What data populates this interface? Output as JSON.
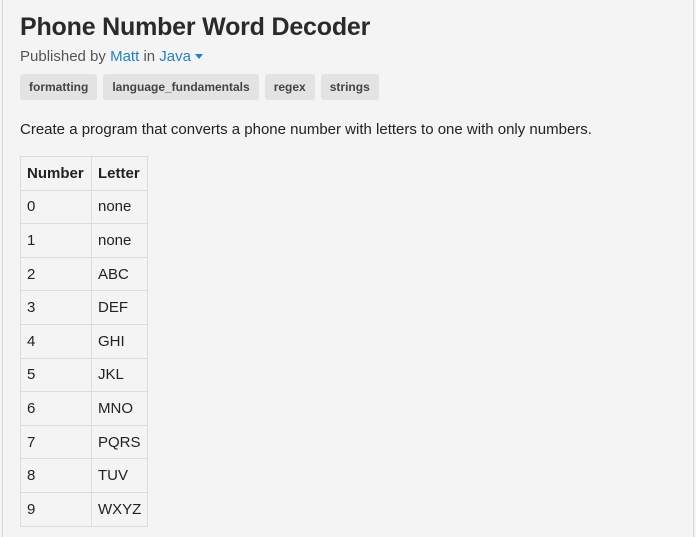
{
  "page": {
    "title": "Phone Number Word Decoder",
    "byline": {
      "prefix": "Published by",
      "author": "Matt",
      "middle": "in",
      "language": "Java"
    },
    "tags": [
      "formatting",
      "language_fundamentals",
      "regex",
      "strings"
    ],
    "description": "Create a program that converts a phone number with letters to one with only numbers."
  },
  "table": {
    "headers": [
      "Number",
      "Letter"
    ],
    "rows": [
      [
        "0",
        "none"
      ],
      [
        "1",
        "none"
      ],
      [
        "2",
        "ABC"
      ],
      [
        "3",
        "DEF"
      ],
      [
        "4",
        "GHI"
      ],
      [
        "5",
        "JKL"
      ],
      [
        "6",
        "MNO"
      ],
      [
        "7",
        "PQRS"
      ],
      [
        "8",
        "TUV"
      ],
      [
        "9",
        "WXYZ"
      ]
    ]
  },
  "colors": {
    "background": "#f4f4f4",
    "link": "#1f7fd3",
    "tag_background": "#e3e3e3"
  }
}
